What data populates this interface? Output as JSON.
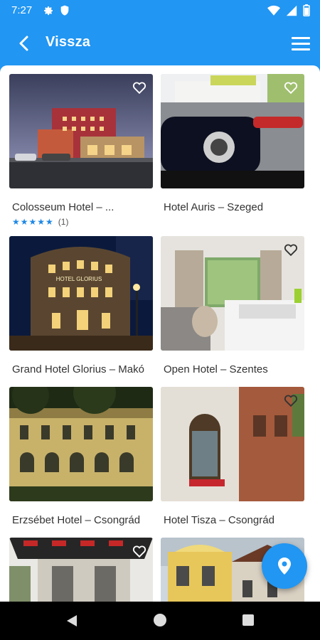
{
  "status_bar": {
    "time": "7:27"
  },
  "app_bar": {
    "title": "Vissza"
  },
  "hotels": [
    {
      "title": "Colosseum Hotel – ...",
      "stars": "★★★★★",
      "reviews": "(1)"
    },
    {
      "title": "Hotel Auris – Szeged"
    },
    {
      "title": "Grand Hotel Glorius – Makó"
    },
    {
      "title": "Open Hotel – Szentes"
    },
    {
      "title": "Erzsébet Hotel – Csongrád"
    },
    {
      "title": "Hotel Tisza – Csongrád"
    },
    {
      "title": ""
    },
    {
      "title": ""
    }
  ],
  "signs": {
    "glorius": "HOTEL GLORIUS"
  },
  "colors": {
    "primary": "#2196f3",
    "star": "#1e88e5"
  }
}
